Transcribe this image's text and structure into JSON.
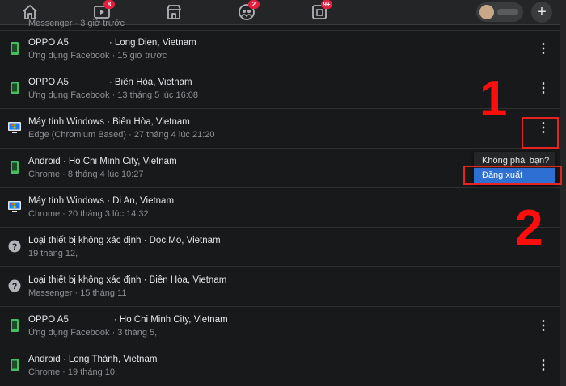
{
  "topbar": {
    "nav": [
      {
        "name": "home",
        "badge": ""
      },
      {
        "name": "watch",
        "badge": "8"
      },
      {
        "name": "marketplace",
        "badge": ""
      },
      {
        "name": "groups",
        "badge": "2"
      },
      {
        "name": "gaming",
        "badge": "9+"
      }
    ],
    "plus_label": "+"
  },
  "sessions": [
    {
      "device": "",
      "location": "",
      "app": "Messenger · 3 giờ trước",
      "icon": "phone-icon"
    },
    {
      "device": "OPPO A5",
      "location": "· Long Dien, Vietnam",
      "app": "Ứng dụng Facebook · 15 giờ trước",
      "icon": "phone-icon"
    },
    {
      "device": "OPPO A5",
      "location": "· Biên Hòa, Vietnam",
      "app": "Ứng dụng Facebook · 13 tháng 5 lúc 16:08",
      "icon": "phone-icon"
    },
    {
      "device": "Máy tính Windows",
      "location": "· Biên Hòa, Vietnam",
      "app": "Edge (Chromium Based) · 27 tháng 4 lúc 21:20",
      "icon": "windows-icon"
    },
    {
      "device": "Android",
      "location": "· Ho Chi Minh City, Vietnam",
      "app": "Chrome · 8 tháng 4 lúc 10:27",
      "icon": "phone-icon"
    },
    {
      "device": "Máy tính Windows",
      "location": "· Di An, Vietnam",
      "app": "Chrome · 20 tháng 3 lúc 14:32",
      "icon": "windows-icon"
    },
    {
      "device": "Loại thiết bị không xác định",
      "location": "· Doc Mo, Vietnam",
      "app": "19 tháng 12,",
      "icon": "question-icon"
    },
    {
      "device": "Loại thiết bị không xác định",
      "location": "· Biên Hòa, Vietnam",
      "app": "Messenger · 15 tháng 11",
      "icon": "question-icon"
    },
    {
      "device": "OPPO A5",
      "location": "· Ho Chi Minh City, Vietnam",
      "app": "Ứng dụng Facebook · 3 tháng 5,",
      "icon": "phone-icon"
    },
    {
      "device": "Android",
      "location": "· Long Thành, Vietnam",
      "app": "Chrome · 19 tháng 10,",
      "icon": "phone-icon"
    }
  ],
  "more_label": "⋮",
  "menu": {
    "not_you": "Không phải bạn?",
    "logout": "Đăng xuất"
  },
  "annotations": {
    "step1": "1",
    "step2": "2"
  },
  "colors": {
    "background": "#18191a",
    "accent_highlight": "#2d6fd3",
    "annotation_red": "#ff0d0d",
    "phone_icon": "#45bd62"
  }
}
